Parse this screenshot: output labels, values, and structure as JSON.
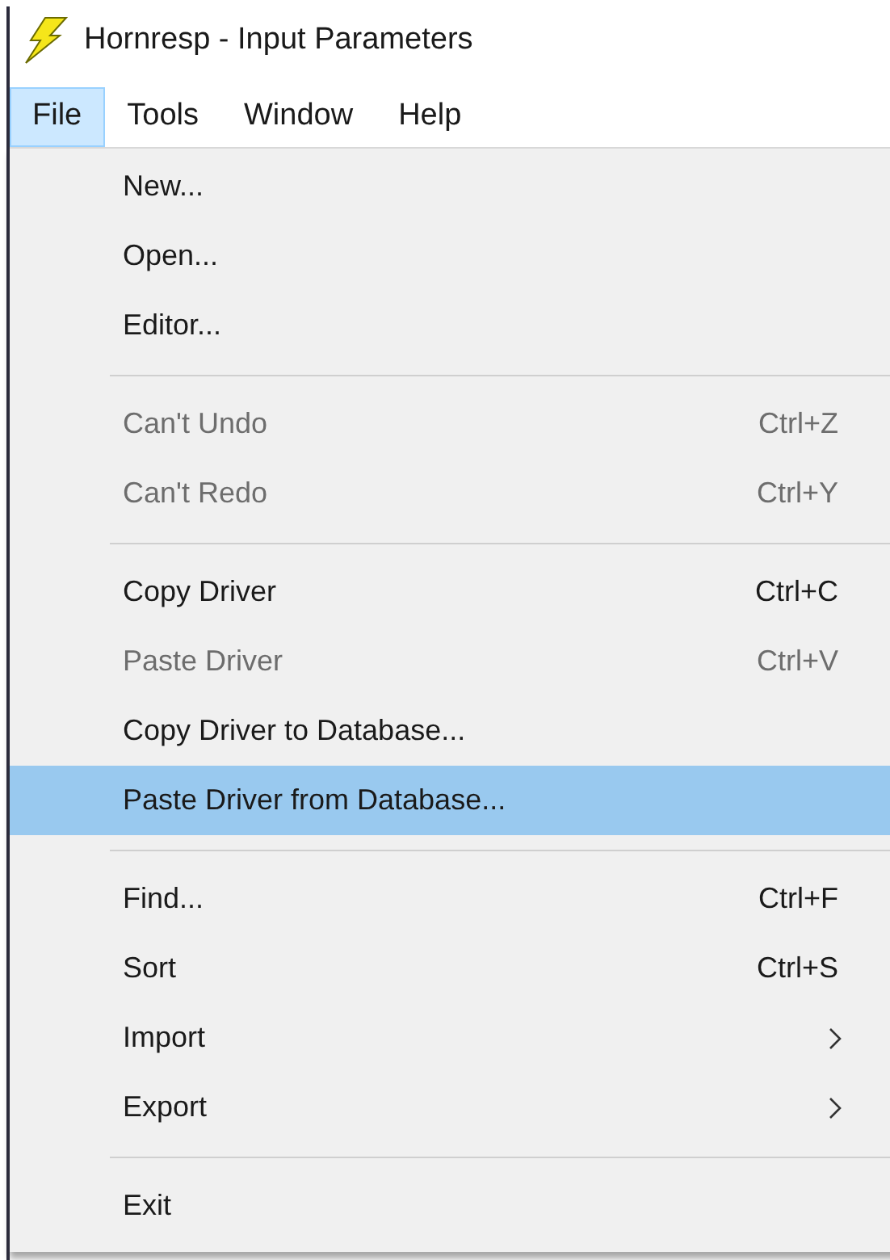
{
  "window": {
    "title": "Hornresp - Input Parameters"
  },
  "menu_bar": [
    {
      "label": "File",
      "selected": true
    },
    {
      "label": "Tools",
      "selected": false
    },
    {
      "label": "Window",
      "selected": false
    },
    {
      "label": "Help",
      "selected": false
    }
  ],
  "menu": [
    {
      "kind": "item",
      "label": "New...",
      "disabled": false,
      "selected": false
    },
    {
      "kind": "item",
      "label": "Open...",
      "disabled": false,
      "selected": false
    },
    {
      "kind": "item",
      "label": "Editor...",
      "disabled": false,
      "selected": false
    },
    {
      "kind": "separator"
    },
    {
      "kind": "item",
      "label": "Can't Undo",
      "shortcut": "Ctrl+Z",
      "disabled": true,
      "selected": false
    },
    {
      "kind": "item",
      "label": "Can't Redo",
      "shortcut": "Ctrl+Y",
      "disabled": true,
      "selected": false
    },
    {
      "kind": "separator"
    },
    {
      "kind": "item",
      "label": "Copy Driver",
      "shortcut": "Ctrl+C",
      "disabled": false,
      "selected": false
    },
    {
      "kind": "item",
      "label": "Paste Driver",
      "shortcut": "Ctrl+V",
      "disabled": true,
      "selected": false
    },
    {
      "kind": "item",
      "label": "Copy Driver to Database...",
      "disabled": false,
      "selected": false
    },
    {
      "kind": "item",
      "label": "Paste Driver from Database...",
      "disabled": false,
      "selected": true
    },
    {
      "kind": "separator"
    },
    {
      "kind": "item",
      "label": "Find...",
      "shortcut": "Ctrl+F",
      "disabled": false,
      "selected": false
    },
    {
      "kind": "item",
      "label": "Sort",
      "shortcut": "Ctrl+S",
      "disabled": false,
      "selected": false
    },
    {
      "kind": "item",
      "label": "Import",
      "submenu": true,
      "disabled": false,
      "selected": false
    },
    {
      "kind": "item",
      "label": "Export",
      "submenu": true,
      "disabled": false,
      "selected": false
    },
    {
      "kind": "separator"
    },
    {
      "kind": "item",
      "label": "Exit",
      "disabled": false,
      "selected": false
    }
  ]
}
